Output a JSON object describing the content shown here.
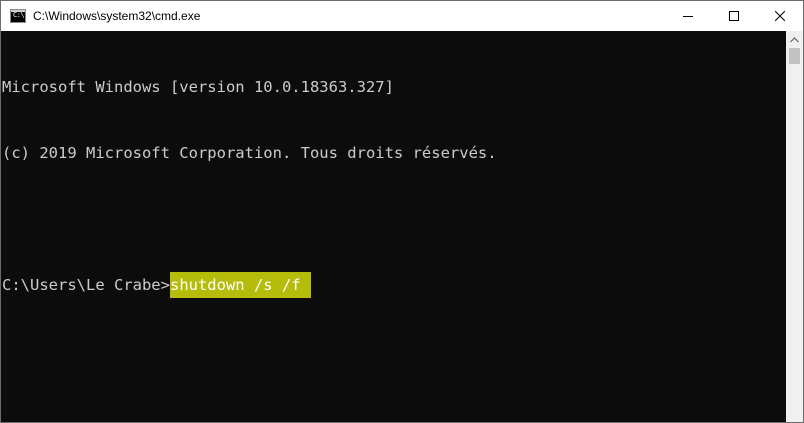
{
  "window": {
    "title": "C:\\Windows\\system32\\cmd.exe",
    "icon": "cmd-icon",
    "icon_text": "C:\\"
  },
  "controls": {
    "minimize_icon": "minimize-icon",
    "maximize_icon": "maximize-icon",
    "close_icon": "close-icon"
  },
  "terminal": {
    "lines": [
      "Microsoft Windows [version 10.0.18363.327]",
      "(c) 2019 Microsoft Corporation. Tous droits réservés.",
      ""
    ],
    "prompt": "C:\\Users\\Le Crabe>",
    "command": "shutdown /s /f"
  },
  "colors": {
    "background": "#0c0c0c",
    "foreground": "#cccccc",
    "highlight": "#b5bc09",
    "highlight_text": "#ffffff"
  }
}
